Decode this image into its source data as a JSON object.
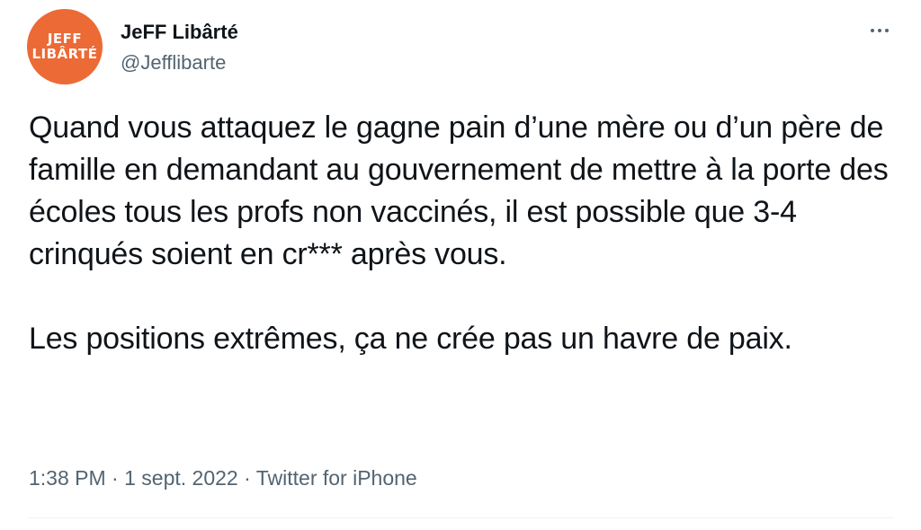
{
  "author": {
    "avatar_line1": "JEFF",
    "avatar_line2": "LIBÂRTÉ",
    "display_name": "JeFF Libârté",
    "handle": "@Jefflibarte"
  },
  "tweet": {
    "paragraph1": "Quand vous attaquez le gagne pain d’une mère ou d’un père de famille en demandant au gouvernement de mettre à la porte des écoles tous les profs non vaccinés, il est possible que 3-4 crinqués soient en cr*** après vous.",
    "paragraph2": "Les positions extrêmes, ça ne crée pas un havre de paix."
  },
  "meta": {
    "time": "1:38 PM",
    "separator": " · ",
    "date": "1 sept. 2022",
    "source": "Twitter for iPhone"
  },
  "icons": {
    "more": "more-horizontal-icon"
  },
  "colors": {
    "avatar_bg": "#ec6a36",
    "text_primary": "#0f1419",
    "text_secondary": "#536471",
    "divider": "#eff3f4"
  }
}
